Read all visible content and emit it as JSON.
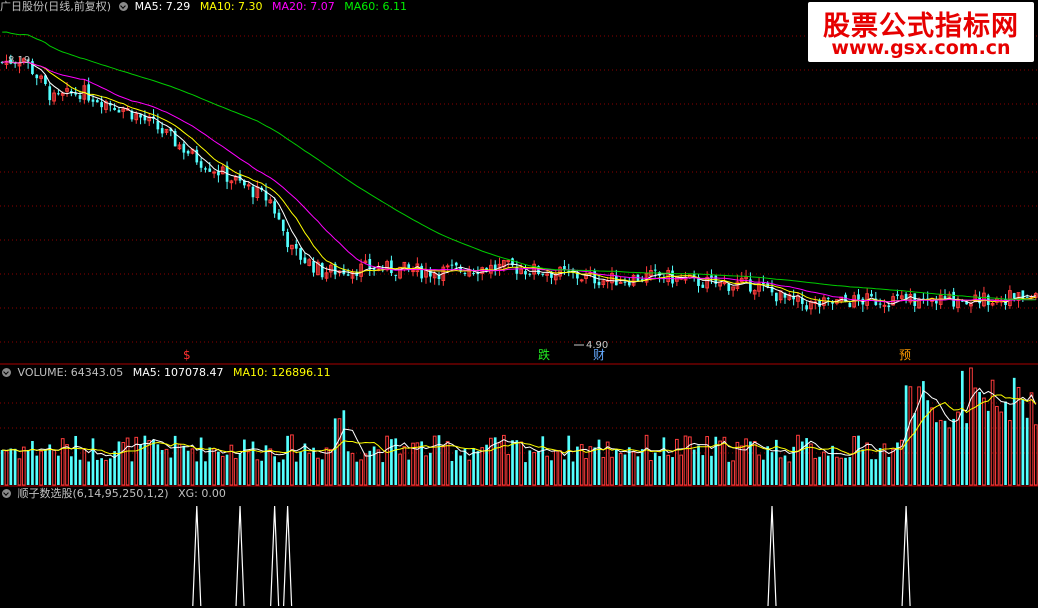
{
  "header_main": {
    "stock": "广日股份(日线,前复权)",
    "ma5_label": "MA5: 7.29",
    "ma10_label": "MA10: 7.30",
    "ma20_label": "MA20: 7.07",
    "ma60_label": "MA60: 6.11"
  },
  "header_volume": {
    "volume_label": "VOLUME: 64343.05",
    "ma5_label": "MA5: 107078.47",
    "ma10_label": "MA10: 126896.11"
  },
  "header_indicator": {
    "formula_label": "顺子数选股(6,14,95,250,1,2)",
    "xg_label": "XG: 0.00"
  },
  "price_labels": {
    "high_label": "8.19",
    "low_label": "4.90"
  },
  "markers": [
    {
      "text": "$",
      "color": "#ff3030"
    },
    {
      "text": "跌",
      "color": "#22ee22"
    },
    {
      "text": "财",
      "color": "#66aaff"
    },
    {
      "text": "预",
      "color": "#ff9900"
    }
  ],
  "watermark": {
    "title": "股票公式指标网",
    "url": "www.gsx.com.cn"
  },
  "colors": {
    "up": "#ff3c3c",
    "down": "#54ffff",
    "ma5": "#ffffff",
    "ma10": "#ffff00",
    "ma20": "#ff00ff",
    "ma60": "#00cc00",
    "grid": "#8b0000",
    "signal": "#ffffff"
  },
  "chart_data": {
    "type": "candlestick",
    "bars": 240,
    "price_axis": {
      "min": 4.5,
      "max": 8.6
    },
    "price_path": [
      [
        0,
        8.05
      ],
      [
        5,
        8.1
      ],
      [
        12,
        7.6
      ],
      [
        18,
        7.7
      ],
      [
        28,
        7.5
      ],
      [
        35,
        7.3
      ],
      [
        45,
        6.9
      ],
      [
        55,
        6.6
      ],
      [
        62,
        6.4
      ],
      [
        67,
        5.8
      ],
      [
        74,
        5.55
      ],
      [
        85,
        5.6
      ],
      [
        100,
        5.55
      ],
      [
        110,
        5.6
      ],
      [
        118,
        5.6
      ],
      [
        126,
        5.55
      ],
      [
        133,
        5.5
      ],
      [
        140,
        5.45
      ],
      [
        152,
        5.5
      ],
      [
        158,
        5.45
      ],
      [
        166,
        5.4
      ],
      [
        174,
        5.4
      ],
      [
        182,
        5.2
      ],
      [
        188,
        5.15
      ],
      [
        196,
        5.2
      ],
      [
        205,
        5.22
      ],
      [
        212,
        5.2
      ],
      [
        220,
        5.22
      ],
      [
        236,
        5.25
      ],
      [
        240,
        5.25
      ]
    ],
    "key_levels": {
      "high": 8.19,
      "low": 4.9
    },
    "volume_ma5": 107078.47,
    "volume_ma10": 126896.11,
    "last_volume": 64343.05,
    "signal_bars": [
      45,
      55,
      63,
      66,
      178,
      209
    ],
    "xg_value": 0.0
  }
}
